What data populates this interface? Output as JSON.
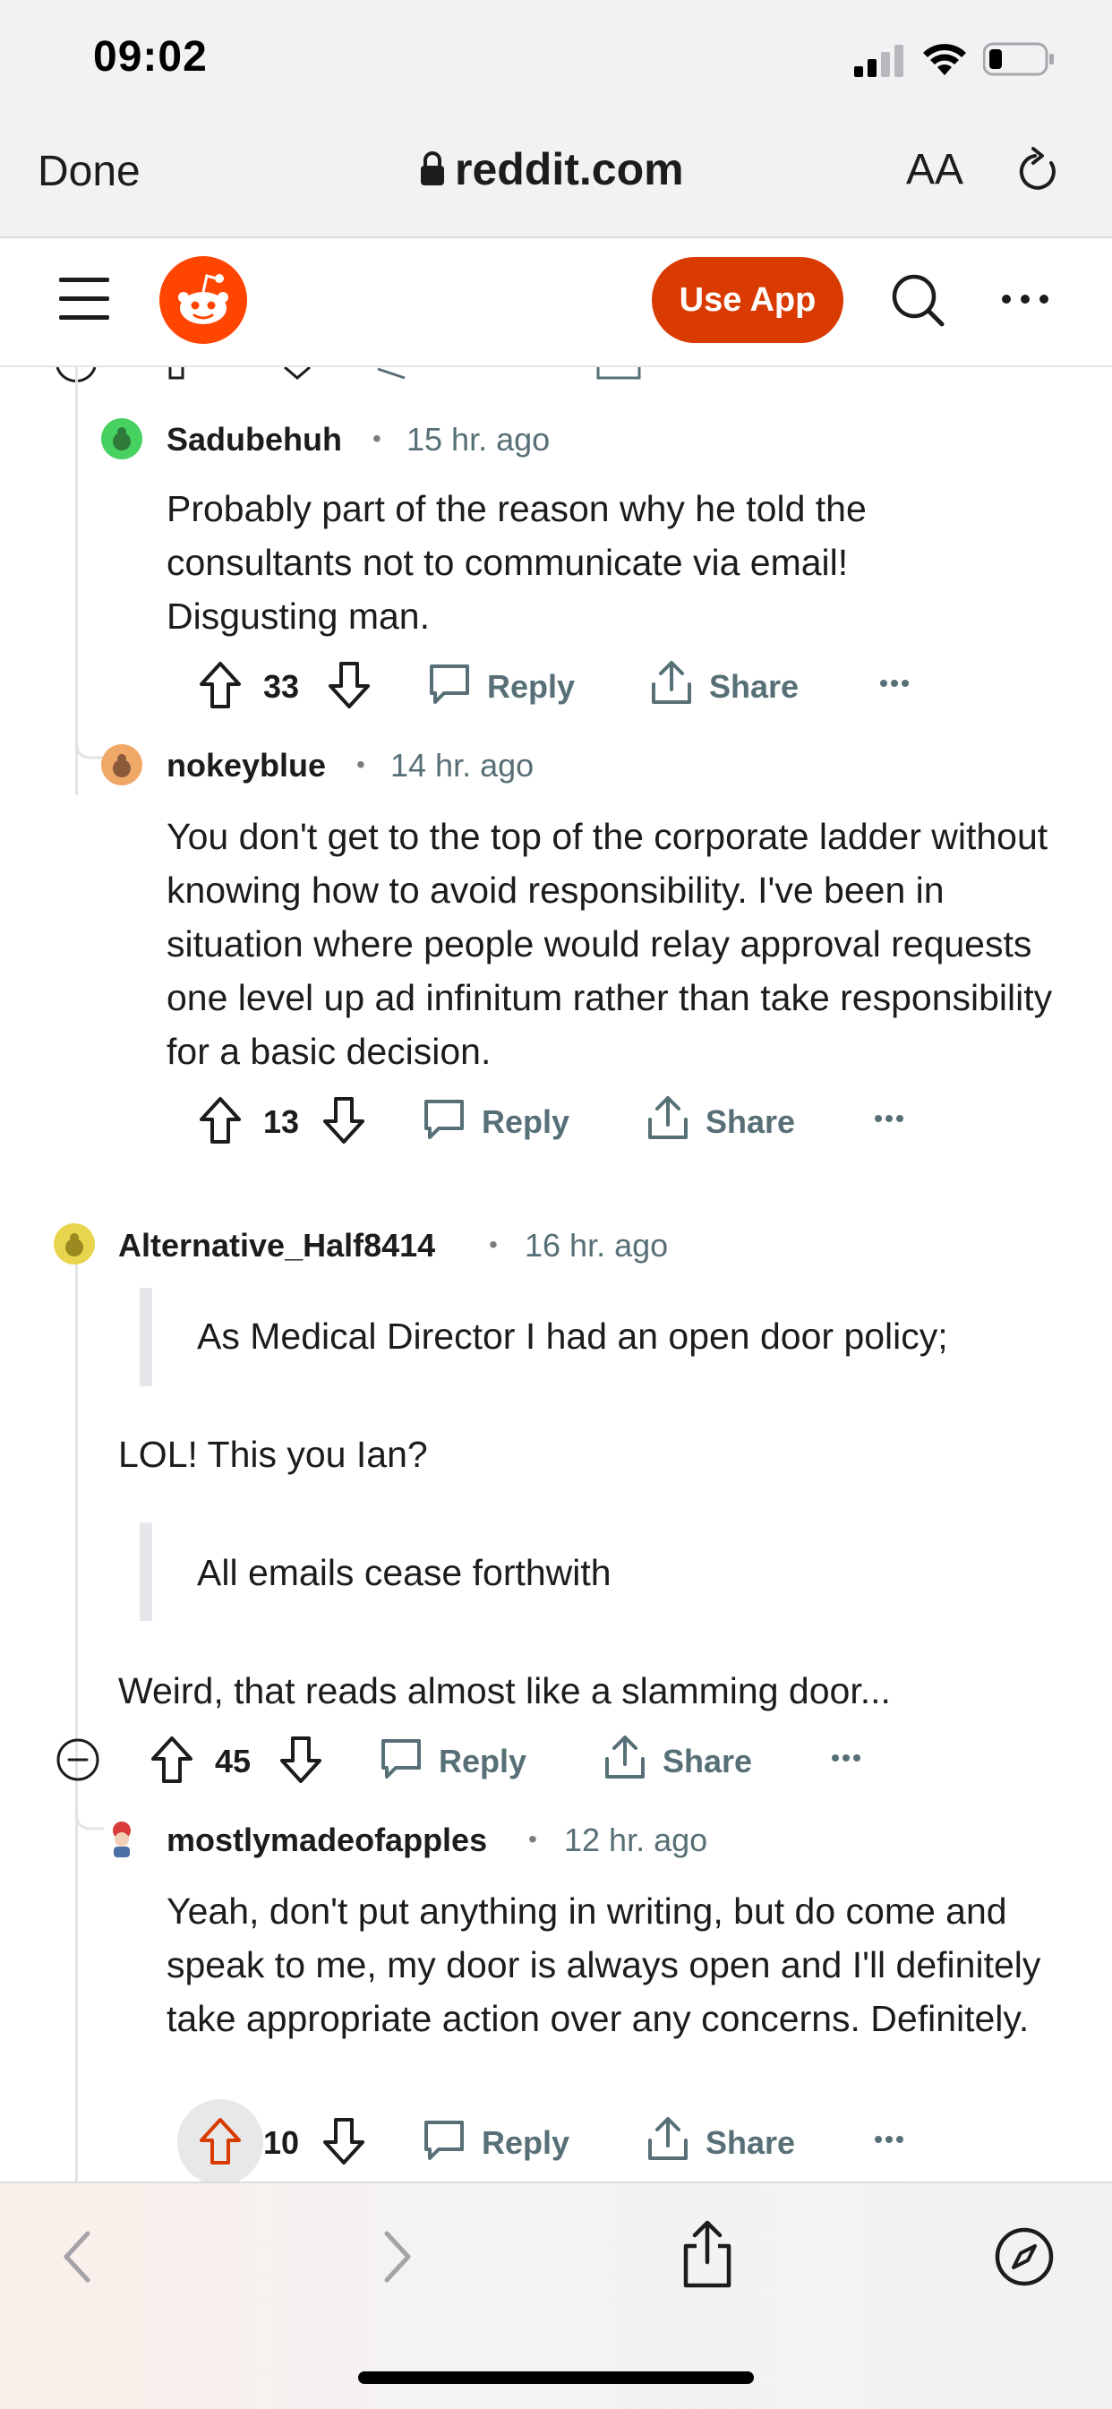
{
  "status_bar": {
    "time": "09:02"
  },
  "safari": {
    "done_label": "Done",
    "url": "reddit.com",
    "text_size_label": "AA"
  },
  "reddit_header": {
    "use_app_label": "Use App"
  },
  "comments": [
    {
      "username": "Sadubehuh",
      "time": "15 hr. ago",
      "body": "Probably part of the reason why he told the consultants not to communicate via email! Disgusting man.",
      "votes": "33",
      "reply_label": "Reply",
      "share_label": "Share",
      "avatar_color": "#46d160"
    },
    {
      "username": "nokeyblue",
      "time": "14 hr. ago",
      "body": "You don't get to the top of the corporate ladder without knowing how to avoid responsibility. I've been in situation where people would relay approval requests one level up ad infinitum rather than take responsibility for a basic decision.",
      "votes": "13",
      "reply_label": "Reply",
      "share_label": "Share",
      "avatar_color": "#f0a868"
    },
    {
      "username": "Alternative_Half8414",
      "time": "16 hr. ago",
      "quote1": "As Medical Director I had an open door policy;",
      "line1": "LOL! This you Ian?",
      "quote2": "All emails cease forthwith",
      "line2": "Weird, that reads almost like a slamming door...",
      "votes": "45",
      "reply_label": "Reply",
      "share_label": "Share",
      "avatar_color": "#e8d44d"
    },
    {
      "username": "mostlymadeofapples",
      "time": "12 hr. ago",
      "body": "Yeah, don't put anything in writing, but do come and speak to me, my door is always open and I'll definitely take appropriate action over any concerns. Definitely.",
      "votes": "10",
      "reply_label": "Reply",
      "share_label": "Share",
      "avatar_color": "#d93a3a"
    }
  ],
  "colors": {
    "reddit_orange": "#ff4500",
    "use_app_bg": "#d93a00",
    "upvote_active": "#d93a00"
  }
}
